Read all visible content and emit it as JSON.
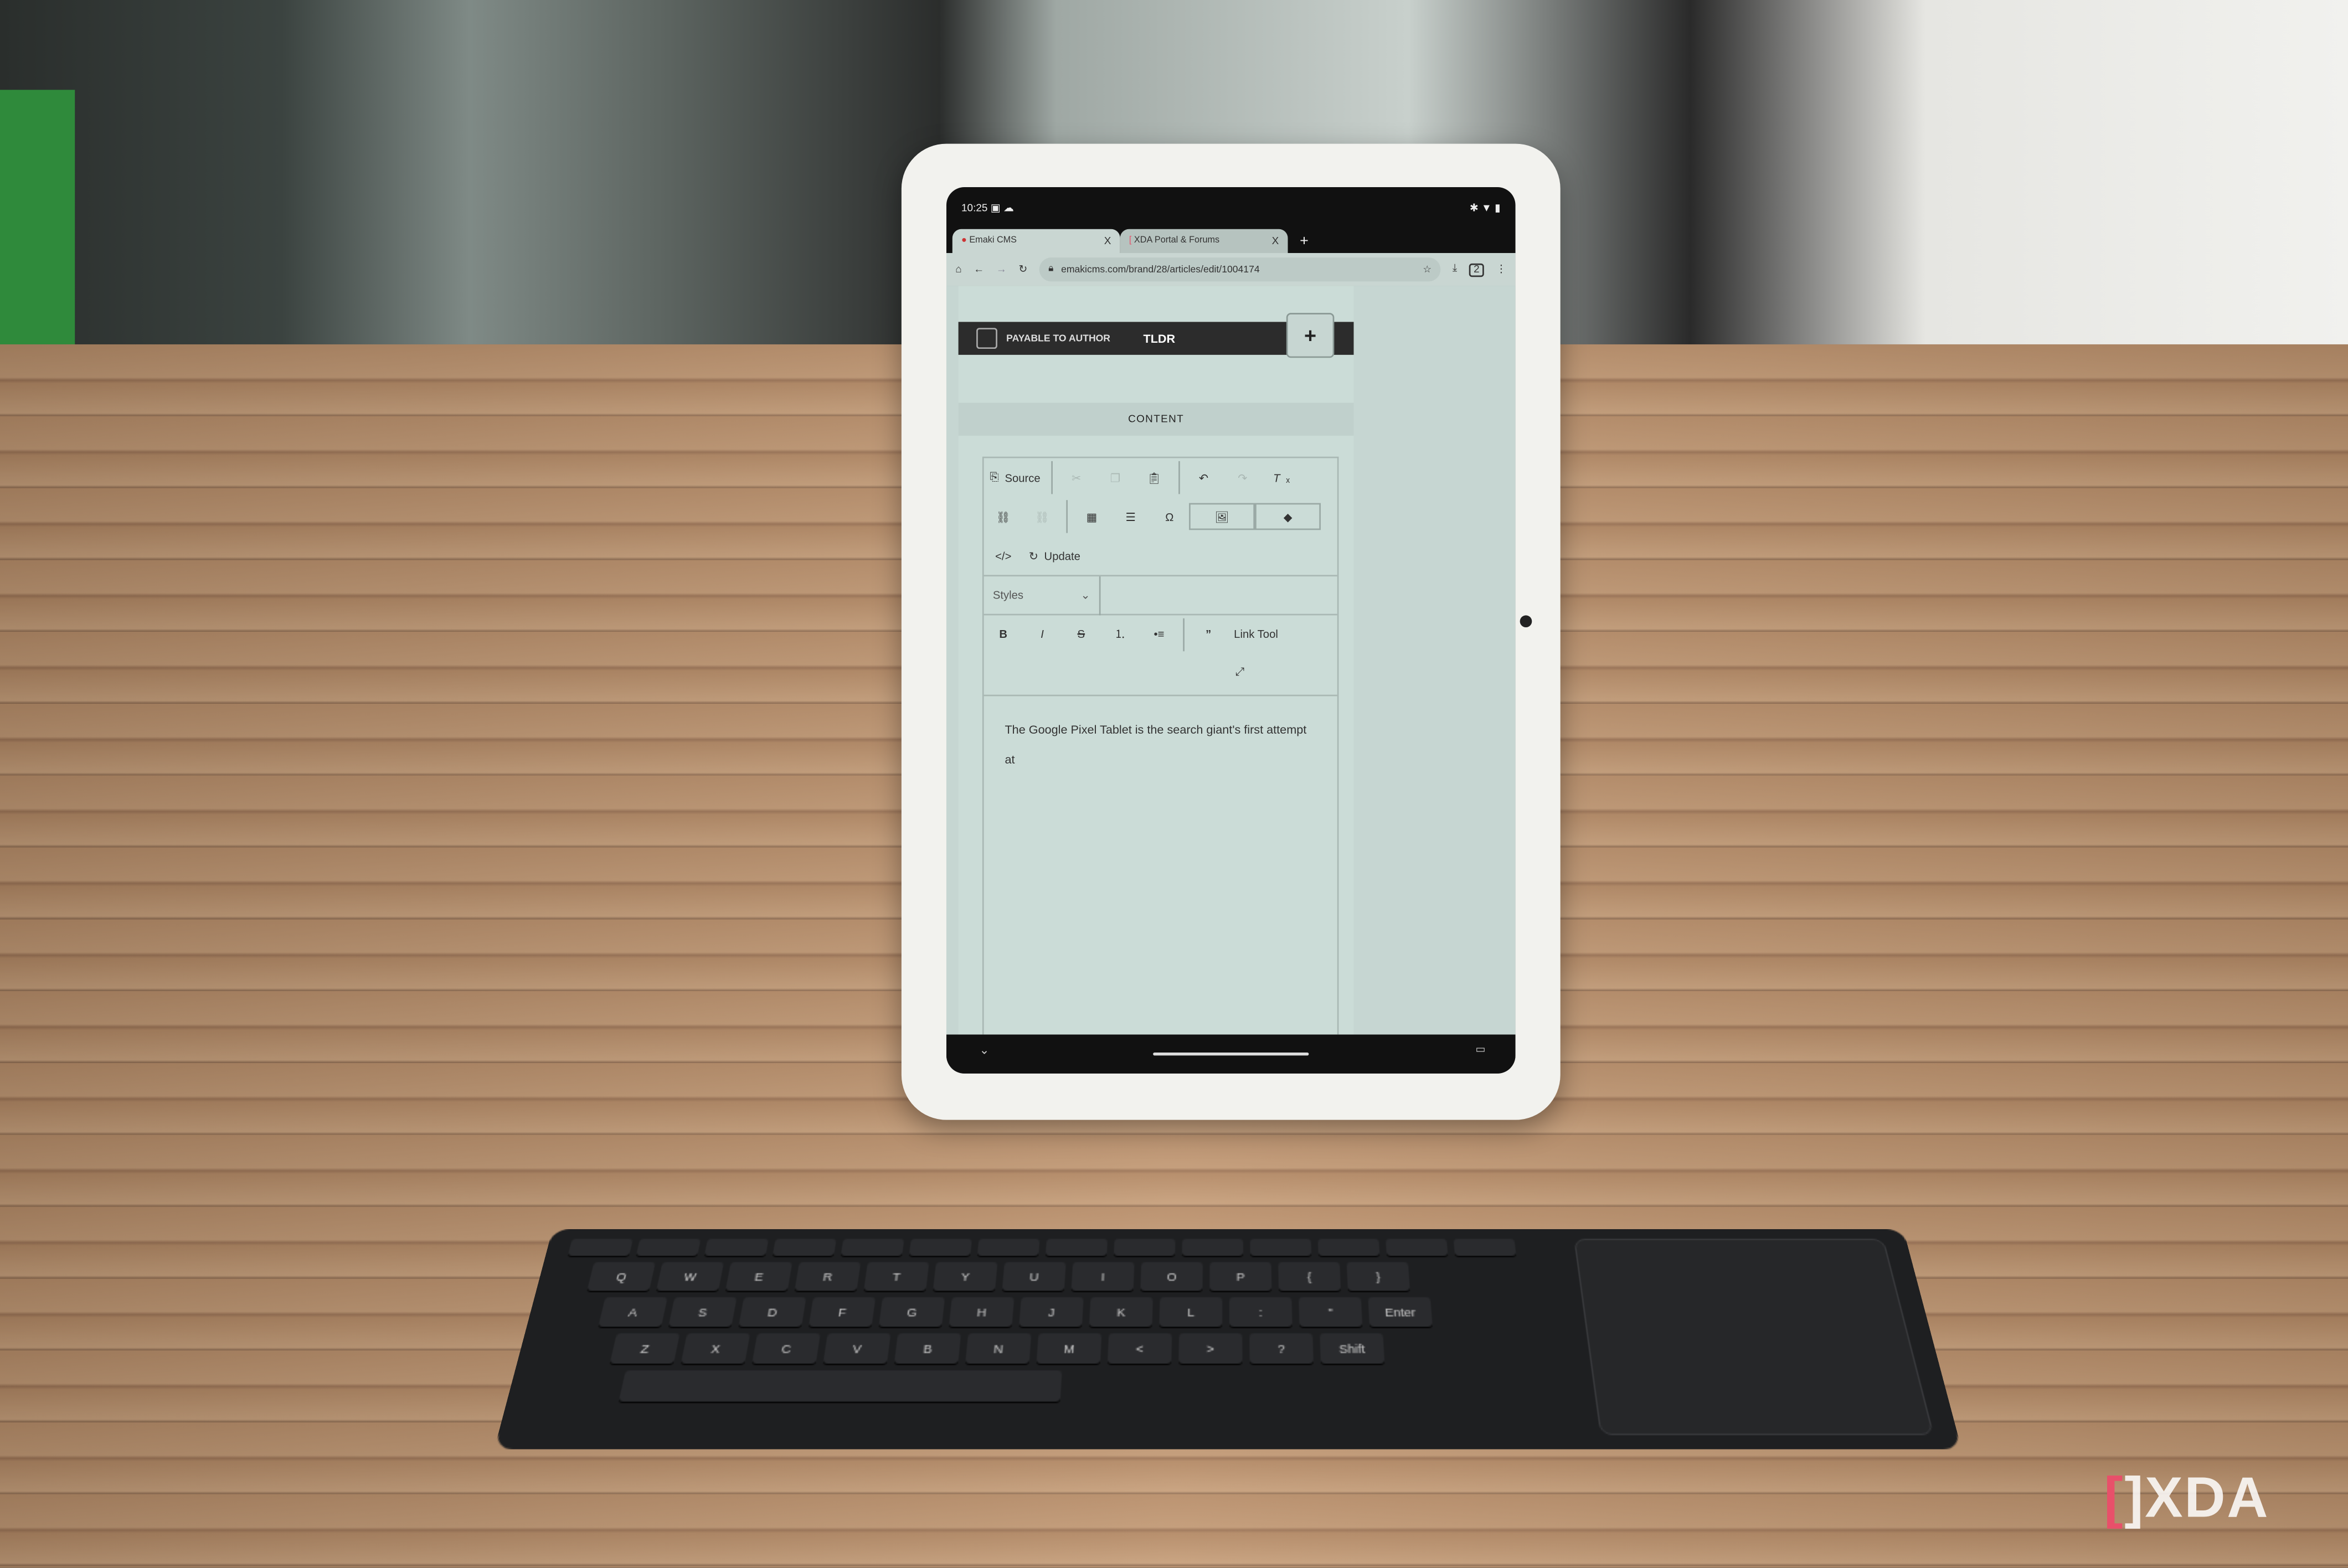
{
  "status_bar": {
    "time": "10:25",
    "icons": [
      "calendar-icon",
      "a-icon",
      "cloud-icon",
      "bluetooth-icon",
      "wifi-icon",
      "battery-icon"
    ]
  },
  "browser": {
    "tabs": [
      {
        "label": "Emaki CMS",
        "active": true
      },
      {
        "label": "XDA Portal & Forums",
        "active": false
      }
    ],
    "close_glyph": "X",
    "new_tab": "+",
    "url": "emakicms.com/brand/28/articles/edit/1004174",
    "tab_count": "2"
  },
  "cms": {
    "payable_label": "PAYABLE TO AUTHOR",
    "payable_checked": false,
    "tldr_label": "TLDR",
    "add_button": "+",
    "content_header": "CONTENT",
    "toolbar": {
      "source": "Source",
      "update": "Update",
      "styles": "Styles",
      "link_tool": "Link Tool"
    },
    "body_text": "The Google Pixel Tablet is the search giant's first attempt at"
  },
  "keyboard": {
    "rows": [
      [
        "Q",
        "W",
        "E",
        "R",
        "T",
        "Y",
        "U",
        "I",
        "O",
        "P",
        "{",
        "}"
      ],
      [
        "A",
        "S",
        "D",
        "F",
        "G",
        "H",
        "J",
        "K",
        "L",
        ":",
        "\"",
        "Enter"
      ],
      [
        "Z",
        "X",
        "C",
        "V",
        "B",
        "N",
        "M",
        "<",
        ">",
        "?",
        "Shift"
      ]
    ]
  },
  "watermark": {
    "text": "XDA"
  },
  "colors": {
    "screen_bg": "#c9d6d2",
    "dark_bar": "#2c2c2c",
    "brand_red": "#e8506a"
  }
}
